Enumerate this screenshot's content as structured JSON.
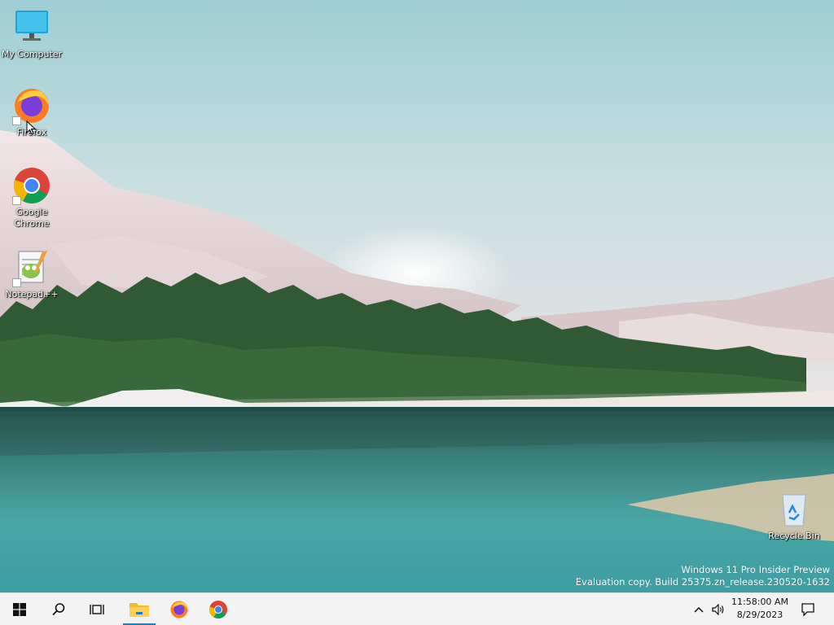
{
  "desktop": {
    "icons": [
      {
        "label": "My Computer",
        "icon": "monitor-icon"
      },
      {
        "label": "Firefox",
        "icon": "firefox-icon"
      },
      {
        "label": "Google Chrome",
        "icon": "chrome-icon"
      },
      {
        "label": "Notepad++",
        "icon": "notepad-plus-plus-icon"
      },
      {
        "label": "Recycle Bin",
        "icon": "recycle-bin-icon"
      }
    ],
    "watermark": {
      "line1": "Windows 11 Pro Insider Preview",
      "line2": "Evaluation copy. Build 25375.zn_release.230520-1632"
    }
  },
  "taskbar": {
    "items": [
      {
        "name": "start",
        "icon": "windows-logo-icon"
      },
      {
        "name": "search",
        "icon": "search-icon"
      },
      {
        "name": "task-view",
        "icon": "task-view-icon"
      },
      {
        "name": "file-explorer",
        "icon": "folder-icon"
      },
      {
        "name": "firefox",
        "icon": "firefox-icon"
      },
      {
        "name": "chrome",
        "icon": "chrome-icon"
      }
    ],
    "tray": {
      "time": "11:58:00 AM",
      "date": "8/29/2023"
    }
  },
  "colors": {
    "taskbar_bg": "#f3f3f3",
    "accent": "#2a7ab0",
    "water": "#3f9c9a",
    "sky": "#a9d2d6"
  }
}
